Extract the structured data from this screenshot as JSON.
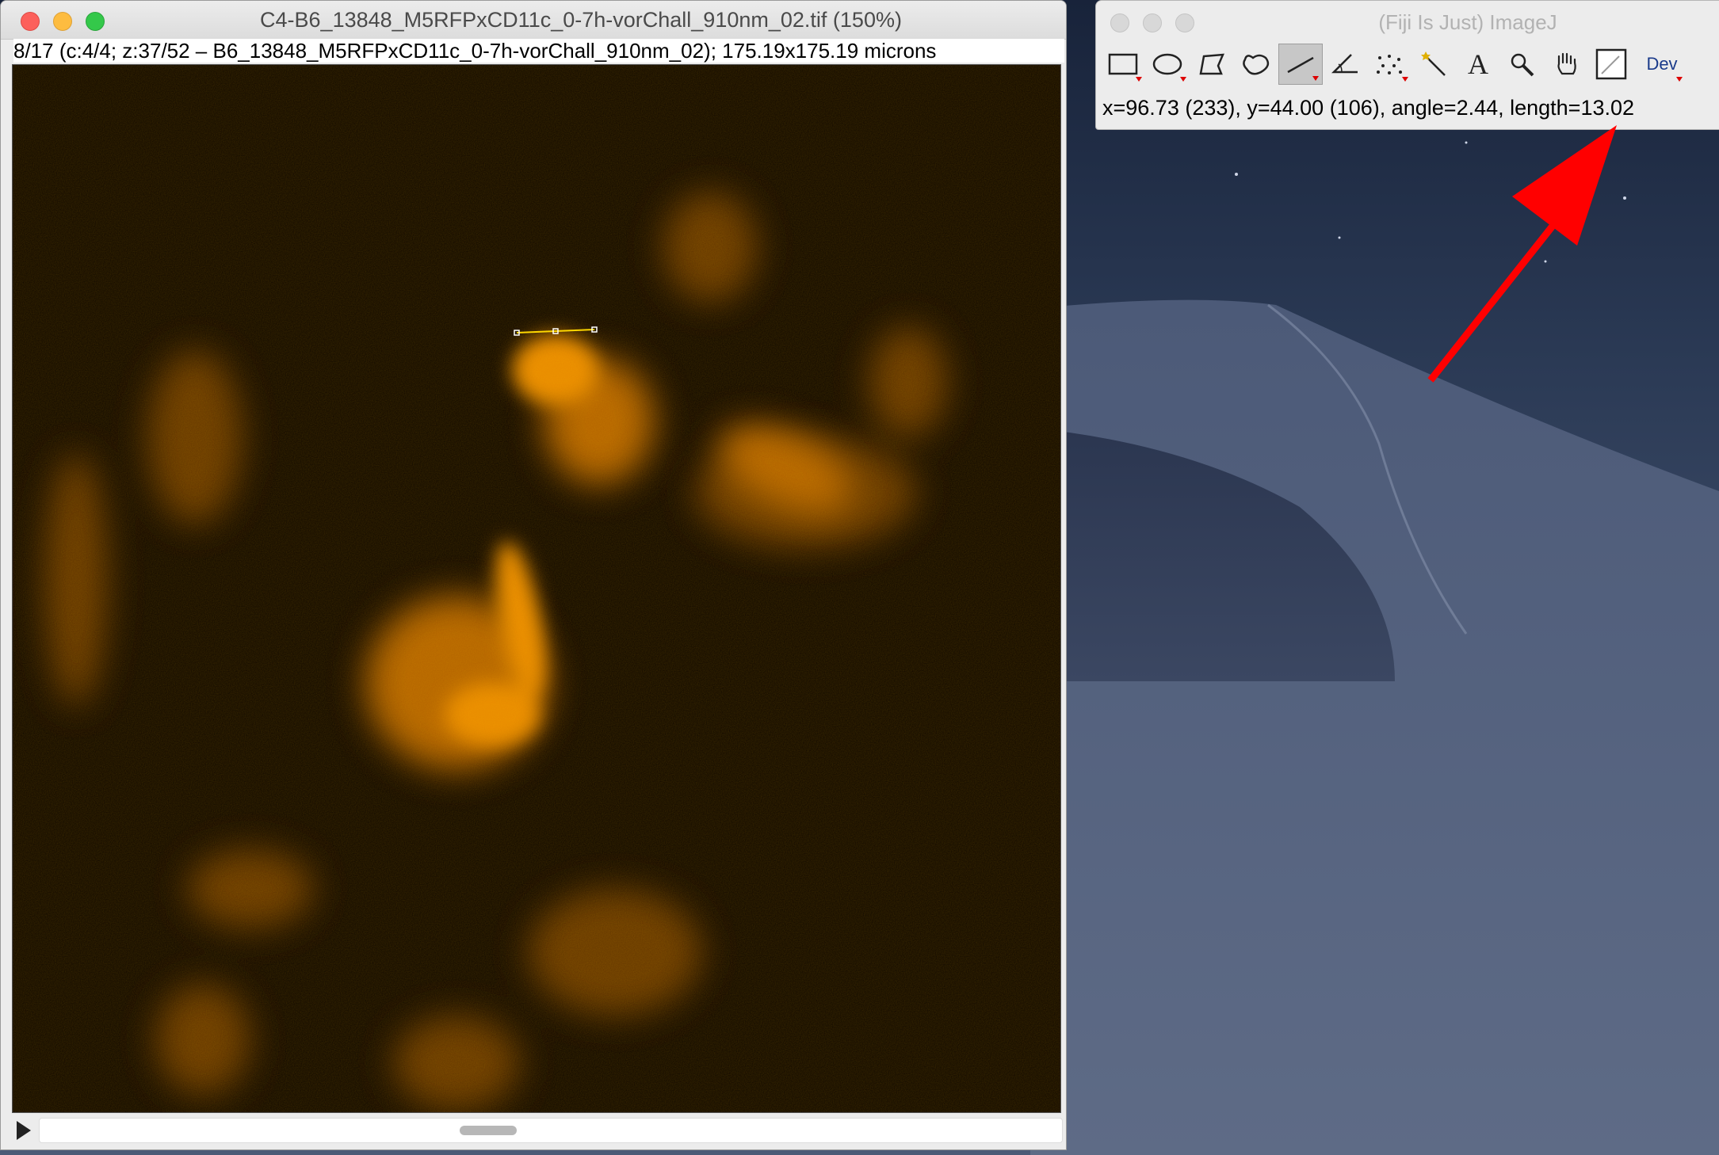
{
  "image_window": {
    "title": "C4-B6_13848_M5RFPxCD11c_0-7h-vorChall_910nm_02.tif (150%)",
    "subtitle": "8/17 (c:4/4; z:37/52 – B6_13848_M5RFPxCD11c_0-7h-vorChall_910nm_02); 175.19x175.19 microns"
  },
  "imagej_window": {
    "title": "(Fiji Is Just) ImageJ",
    "status": "x=96.73 (233), y=44.00 (106), angle=2.44, length=13.02",
    "tools": [
      {
        "name": "rectangle-tool-icon"
      },
      {
        "name": "oval-tool-icon"
      },
      {
        "name": "polygon-tool-icon"
      },
      {
        "name": "freehand-tool-icon"
      },
      {
        "name": "line-tool-icon",
        "active": true
      },
      {
        "name": "angle-tool-icon"
      },
      {
        "name": "multipoint-tool-icon"
      },
      {
        "name": "wand-tool-icon"
      },
      {
        "name": "text-tool-icon",
        "label": "A"
      },
      {
        "name": "magnifier-tool-icon"
      },
      {
        "name": "hand-tool-icon"
      },
      {
        "name": "color-picker-tool-icon"
      },
      {
        "name": "dev-menu-icon",
        "label": "Dev"
      }
    ]
  },
  "colors": {
    "accent_arrow": "#ff0000",
    "image_lut": "#ff9a00",
    "selection_line": "#ffd800"
  }
}
